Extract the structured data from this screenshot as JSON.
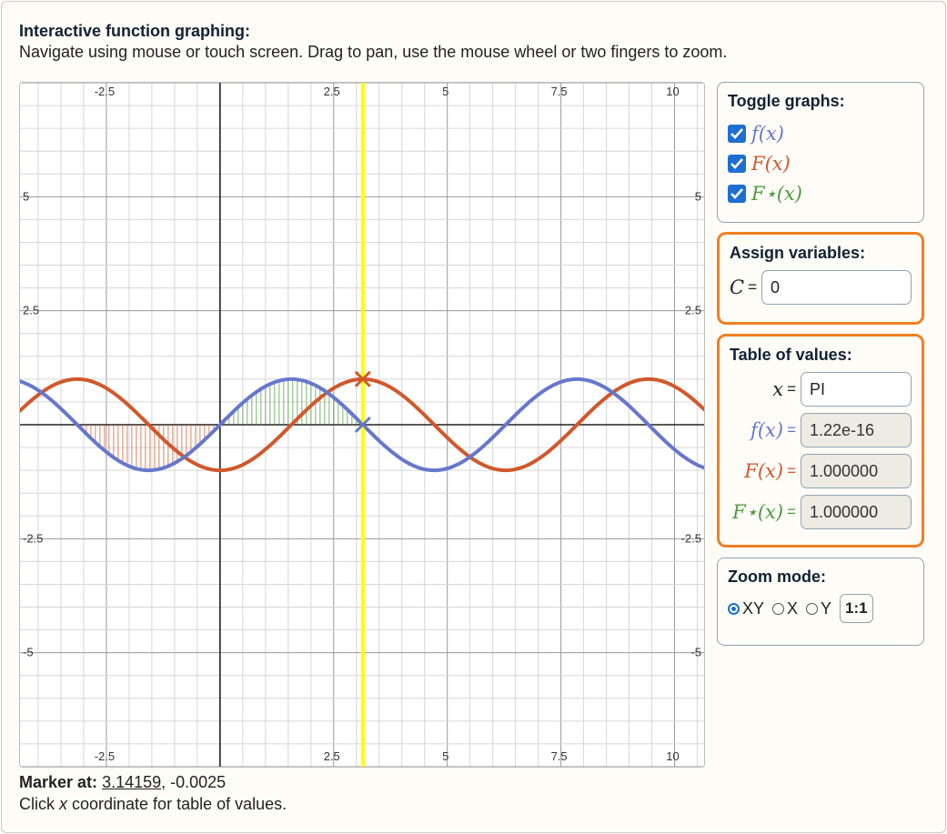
{
  "header": {
    "title": "Interactive function graphing:",
    "subtitle": "Navigate using mouse or touch screen. Drag to pan, use the mouse wheel or two fingers to zoom."
  },
  "colors": {
    "f": "#6677cc",
    "F": "#d0582b",
    "Fstar": "#4d9a3f",
    "marker_line": "#ffff00",
    "highlight_border": "#f08020",
    "checkbox": "#1f6fd1"
  },
  "toggle_panel": {
    "title": "Toggle graphs:",
    "items": [
      {
        "label": "f(x)",
        "checked": true
      },
      {
        "label": "F(x)",
        "checked": true
      },
      {
        "label": "F⋆(x)",
        "checked": true
      }
    ]
  },
  "variables_panel": {
    "title": "Assign variables:",
    "var_name": "C",
    "eq": "=",
    "value": "0"
  },
  "table_panel": {
    "title": "Table of values:",
    "x_label": "x",
    "x_value": "PI",
    "rows": [
      {
        "label": "f(x)",
        "value": "1.22e-16"
      },
      {
        "label": "F(x)",
        "value": "1.000000"
      },
      {
        "label": "F⋆(x)",
        "value": "1.000000"
      }
    ],
    "eq": "="
  },
  "zoom_panel": {
    "title": "Zoom mode:",
    "options": [
      {
        "label": "XY",
        "selected": true
      },
      {
        "label": "X",
        "selected": false
      },
      {
        "label": "Y",
        "selected": false
      }
    ],
    "ratio_button": "1:1"
  },
  "footer": {
    "marker_label": "Marker at:",
    "marker_x": "3.14159",
    "marker_y": ", -0.0025",
    "hint_pre": "Click ",
    "hint_var": "x",
    "hint_post": " coordinate for table of values."
  },
  "chart_data": {
    "type": "line",
    "title": "",
    "xlabel": "",
    "ylabel": "",
    "xlim": [
      -4.4,
      10.65
    ],
    "ylim": [
      -7.5,
      7.5
    ],
    "grid": true,
    "x_tick_labels": [
      "-2.5",
      "2.5",
      "5",
      "7.5",
      "10"
    ],
    "x_tick_values": [
      -2.5,
      2.5,
      5,
      7.5,
      10
    ],
    "y_tick_labels": [
      "5",
      "2.5",
      "-2.5",
      "-5"
    ],
    "y_tick_values": [
      5,
      2.5,
      -2.5,
      -5
    ],
    "series": [
      {
        "name": "f(x)",
        "expr": "sin(x)",
        "color": "#6677cc"
      },
      {
        "name": "F(x)",
        "expr": "-cos(x)",
        "color": "#d0582b"
      },
      {
        "name": "F⋆(x)",
        "expr": "1 - cos(x)",
        "color": "#4d9a3f"
      }
    ],
    "marker": {
      "x": 3.14159,
      "y": -0.0025
    },
    "marker_points": [
      {
        "series": "f(x)",
        "x": 3.14159,
        "y": 0
      },
      {
        "series": "F(x)",
        "x": 3.14159,
        "y": 1
      }
    ],
    "shaded_areas": [
      {
        "series": "F(x)",
        "from": -3.14159,
        "to": 0,
        "color": "#d0582b"
      },
      {
        "series": "F⋆(x)",
        "from": 0,
        "to": 3.14159,
        "color": "#4d9a3f"
      }
    ]
  }
}
